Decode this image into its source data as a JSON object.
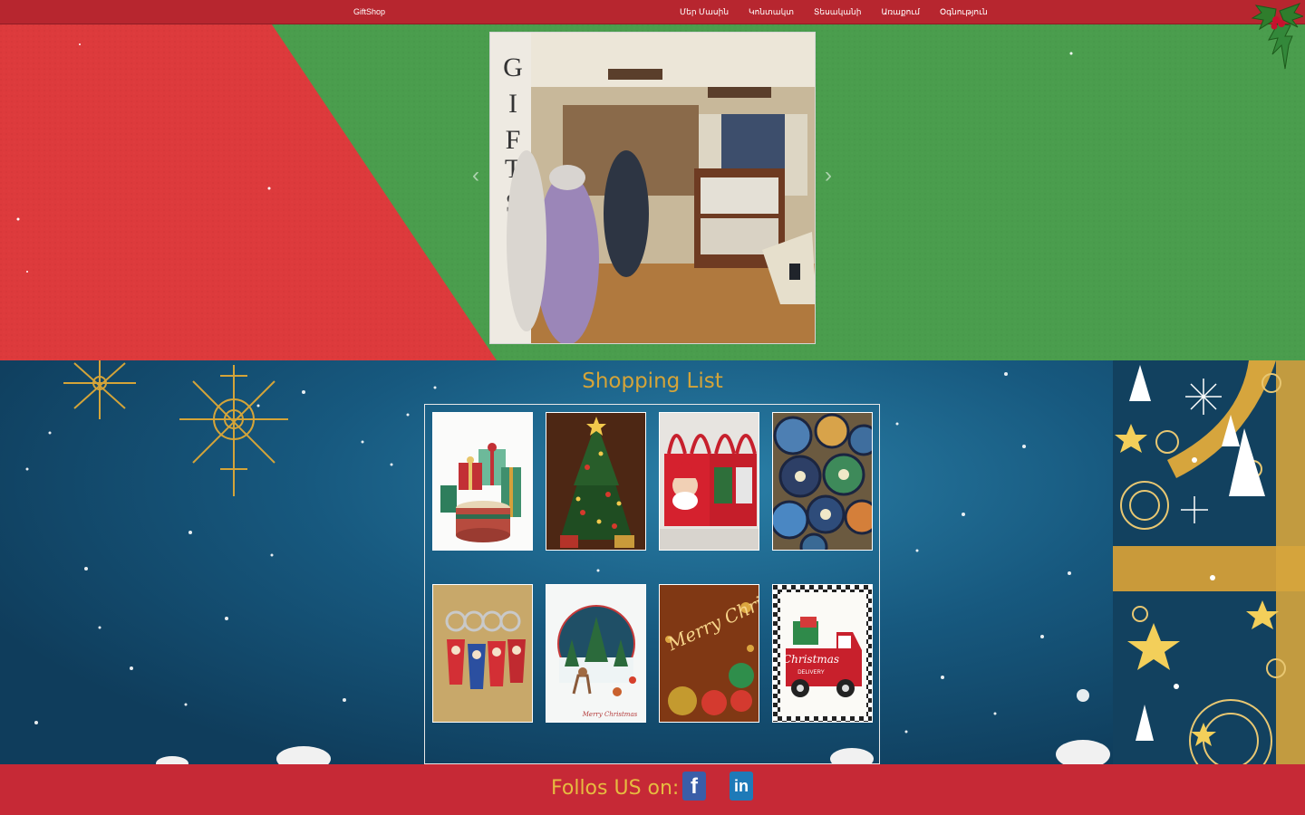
{
  "navbar": {
    "brand": "GiftShop",
    "links": [
      "Մեր Մասին",
      "Կոնտակտ",
      "Տեսականի",
      "Առաքում",
      "Օգնություն"
    ]
  },
  "shop": {
    "title": "Shopping List",
    "items": [
      {
        "icon": "gift-boxes-image"
      },
      {
        "icon": "christmas-tree-image"
      },
      {
        "icon": "christmas-bags-image"
      },
      {
        "icon": "decorative-plates-image"
      },
      {
        "icon": "keychains-image"
      },
      {
        "icon": "christmas-card-image"
      },
      {
        "icon": "merry-christmas-image"
      },
      {
        "icon": "christmas-truck-image"
      }
    ],
    "card_script": "Merry Christmas",
    "merry_script": "Merry Christmas",
    "truck_script": "Christmas",
    "truck_word": "DELIVERY",
    "hero_sign": "GIFTS"
  },
  "footer": {
    "follow": "Follos US on:",
    "facebook": "f",
    "linkedin": "in"
  },
  "colors": {
    "navbar": "#b7262f",
    "hero_green": "#4a9d4d",
    "hero_red": "#dd3a3c",
    "section_blue": "#17597f",
    "gold": "#d4a439",
    "footer": "#c62936"
  }
}
